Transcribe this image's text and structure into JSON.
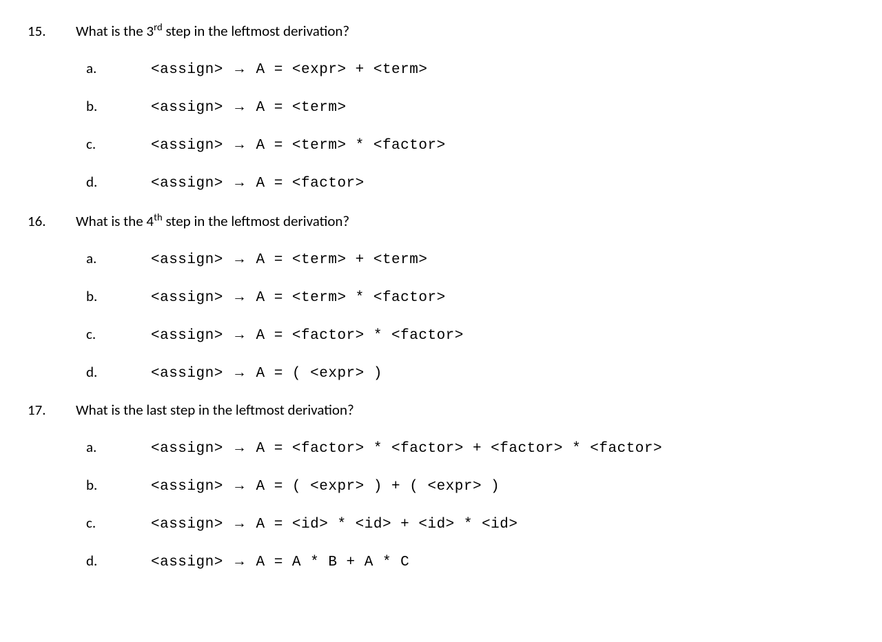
{
  "questions": [
    {
      "number": "15.",
      "text_before": "What is the 3",
      "ordinal": "rd",
      "text_after": " step in the leftmost derivation?",
      "options": [
        {
          "letter": "a.",
          "prefix": "<assign> ",
          "arrow": "→",
          "code": " A = <expr> + <term>"
        },
        {
          "letter": "b.",
          "prefix": "<assign> ",
          "arrow": "→",
          "code": " A = <term>"
        },
        {
          "letter": "c.",
          "prefix": "<assign> ",
          "arrow": "→",
          "code": " A = <term> * <factor>"
        },
        {
          "letter": "d.",
          "prefix": "<assign> ",
          "arrow": "→",
          "code": " A = <factor>"
        }
      ]
    },
    {
      "number": "16.",
      "text_before": "What is the 4",
      "ordinal": "th",
      "text_after": " step in the leftmost derivation?",
      "options": [
        {
          "letter": "a.",
          "prefix": "<assign> ",
          "arrow": "→",
          "code": " A = <term> + <term>"
        },
        {
          "letter": "b.",
          "prefix": "<assign> ",
          "arrow": "→",
          "code": " A = <term> * <factor>"
        },
        {
          "letter": "c.",
          "prefix": "<assign> ",
          "arrow": "→",
          "code": " A = <factor> * <factor>"
        },
        {
          "letter": "d.",
          "prefix": "<assign> ",
          "arrow": "→",
          "code": " A = ( <expr> )"
        }
      ]
    },
    {
      "number": "17.",
      "text_before": "What is the last step in the leftmost derivation?",
      "ordinal": "",
      "text_after": "",
      "options": [
        {
          "letter": "a.",
          "prefix": "<assign> ",
          "arrow": "→",
          "code": " A = <factor> * <factor> + <factor> * <factor>"
        },
        {
          "letter": "b.",
          "prefix": "<assign> ",
          "arrow": "→",
          "code": " A = ( <expr> ) + ( <expr> )"
        },
        {
          "letter": "c.",
          "prefix": "<assign> ",
          "arrow": "→",
          "code": " A = <id> * <id> + <id> * <id>"
        },
        {
          "letter": "d.",
          "prefix": "<assign> ",
          "arrow": "→",
          "code": " A = A * B + A * C"
        }
      ]
    }
  ]
}
